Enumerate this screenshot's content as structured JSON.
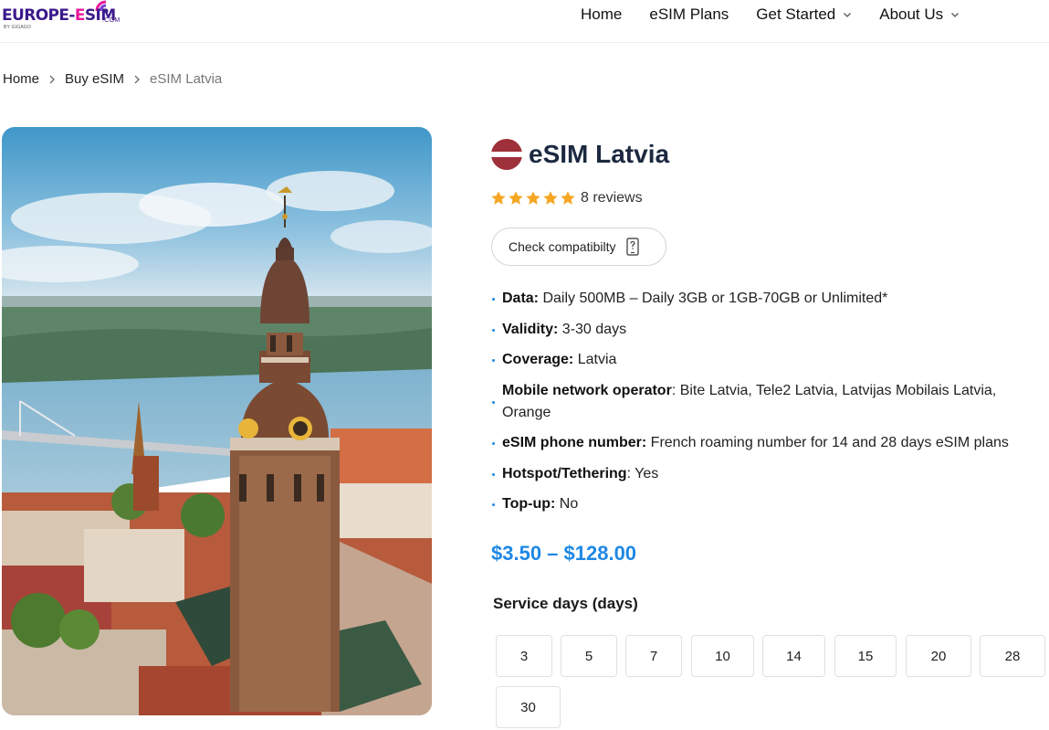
{
  "header": {
    "logo": {
      "part1": "EUROPE-",
      "part2": "E",
      "part3": "SIM",
      "com": ".COM",
      "by": "BY GIGAGO"
    },
    "nav": [
      {
        "label": "Home",
        "has_dropdown": false
      },
      {
        "label": "eSIM Plans",
        "has_dropdown": false
      },
      {
        "label": "Get Started",
        "has_dropdown": true
      },
      {
        "label": "About Us",
        "has_dropdown": true
      }
    ]
  },
  "breadcrumb": {
    "items": [
      "Home",
      "Buy eSIM"
    ],
    "current": "eSIM Latvia"
  },
  "product": {
    "title": "eSIM Latvia",
    "flag_colors": [
      "#9e3039",
      "#ffffff",
      "#9e3039"
    ],
    "rating": 5,
    "reviews": "8 reviews",
    "compat_button": "Check compatibilty",
    "features": [
      {
        "label": "Data:",
        "value": " Daily 500MB – Daily 3GB or 1GB-70GB or Unlimited*"
      },
      {
        "label": "Validity:",
        "value": " 3-30 days"
      },
      {
        "label": "Coverage:",
        "value": " Latvia"
      },
      {
        "label": "Mobile network operator",
        "value": ": Bite Latvia, Tele2 Latvia, Latvijas Mobilais Latvia, Orange"
      },
      {
        "label": "eSIM phone number:",
        "value": " French roaming number for 14 and 28 days eSIM plans"
      },
      {
        "label": "Hotspot/Tethering",
        "value": ": Yes"
      },
      {
        "label": "Top-up:",
        "value": " No"
      }
    ],
    "price": "$3.50 – $128.00",
    "service_days_label": "Service days (days)",
    "service_days": [
      "3",
      "5",
      "7",
      "10",
      "14",
      "15",
      "20",
      "28",
      "30"
    ]
  },
  "colors": {
    "accent": "#1e88e5",
    "title": "#1c2940",
    "star": "#f5a623"
  },
  "icons": [
    "chevron-down-icon",
    "chevron-right-icon",
    "star-icon",
    "phone-question-icon",
    "latvia-flag-icon"
  ]
}
